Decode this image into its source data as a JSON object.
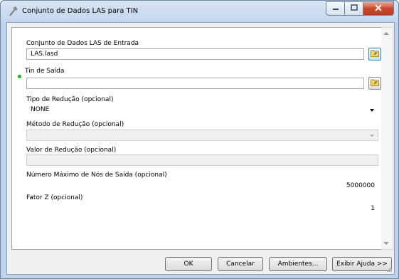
{
  "window": {
    "title": "Conjunto de Dados LAS para TIN",
    "icon": "hammer-icon"
  },
  "titlebar_buttons": {
    "minimize": "minimize-icon",
    "maximize": "maximize-icon",
    "close": "close-icon"
  },
  "form": {
    "input_dataset": {
      "label": "Conjunto de Dados LAS de Entrada",
      "value": "LAS.lasd"
    },
    "output_tin": {
      "label": "Tin de Saída",
      "value": ""
    },
    "thinning_type": {
      "label": "Tipo de Redução (opcional)",
      "value": "NONE"
    },
    "thinning_method": {
      "label": "Método de Redução (opcional)",
      "value": ""
    },
    "thinning_value": {
      "label": "Valor de Redução (opcional)",
      "value": ""
    },
    "max_nodes": {
      "label": "Número Máximo de Nós de Saída (opcional)",
      "value": "5000000"
    },
    "z_factor": {
      "label": "Fator Z (opcional)",
      "value": "1"
    }
  },
  "buttons": {
    "ok": "OK",
    "cancel": "Cancelar",
    "environments": "Ambientes...",
    "help": "Exibir Ajuda >>"
  },
  "colors": {
    "required_indicator": "#1db31d",
    "close_button": "#c7432a"
  }
}
